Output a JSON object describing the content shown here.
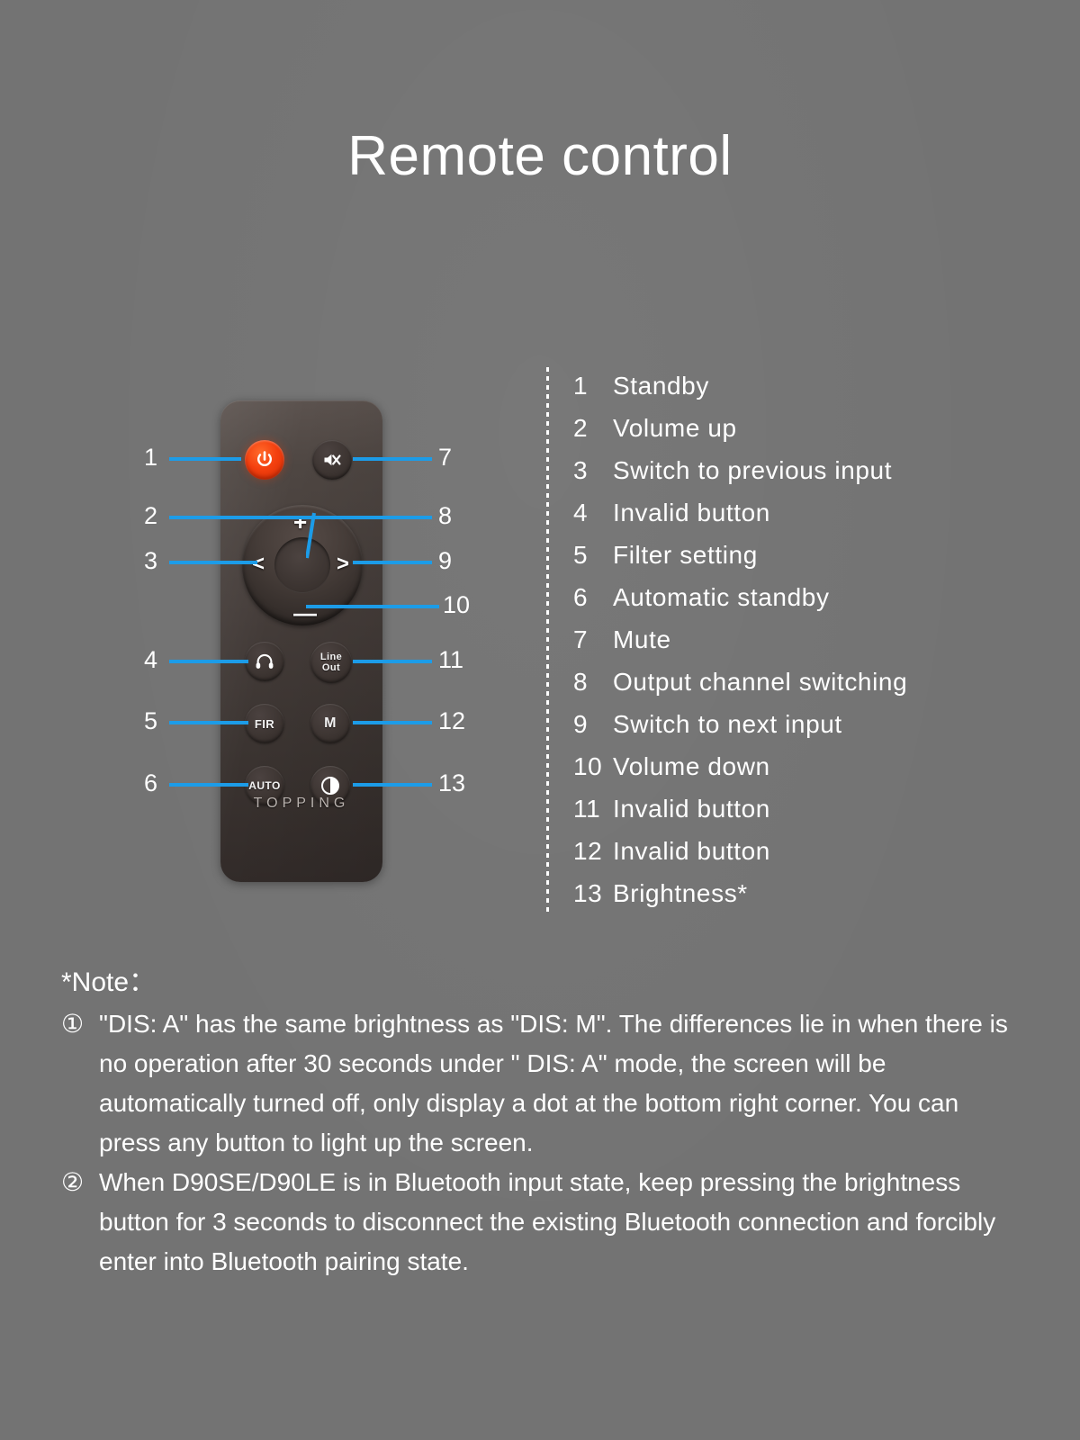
{
  "page": {
    "title": "Remote control",
    "background_color": "#737373",
    "accent_color": "#1c9ce8",
    "power_button_color": "#f4400f"
  },
  "remote": {
    "brand": "TOPPING",
    "buttons": {
      "power": "power-icon",
      "mute": "mute-icon",
      "plus": "+",
      "minus": "—",
      "left": "<",
      "right": ">",
      "headphone": "headphone-icon",
      "line_out_line1": "Line",
      "line_out_line2": "Out",
      "fir": "FIR",
      "m": "M",
      "auto": "AUTO",
      "brightness": "brightness-icon"
    },
    "callout_numbers_left": [
      "1",
      "2",
      "3",
      "4",
      "5",
      "6"
    ],
    "callout_numbers_right": [
      "7",
      "8",
      "9",
      "10",
      "11",
      "12",
      "13"
    ]
  },
  "legend": {
    "items": [
      {
        "num": "1",
        "label": "Standby"
      },
      {
        "num": "2",
        "label": "Volume up"
      },
      {
        "num": "3",
        "label": "Switch to previous input"
      },
      {
        "num": "4",
        "label": "Invalid button"
      },
      {
        "num": "5",
        "label": "Filter setting"
      },
      {
        "num": "6",
        "label": "Automatic standby"
      },
      {
        "num": "7",
        "label": "Mute"
      },
      {
        "num": "8",
        "label": "Output channel switching"
      },
      {
        "num": "9",
        "label": "Switch to next input"
      },
      {
        "num": "10",
        "label": "Volume down"
      },
      {
        "num": "11",
        "label": "Invalid button"
      },
      {
        "num": "12",
        "label": "Invalid button"
      },
      {
        "num": "13",
        "label": "Brightness*"
      }
    ]
  },
  "note": {
    "title": "*Note：",
    "items": [
      {
        "marker": "①",
        "text": "\"DIS: A\" has the same brightness as \"DIS: M\". The differences lie in when there is no operation after 30 seconds under \" DIS: A\" mode, the screen will be automatically turned off, only display a dot at the bottom right corner. You can press any button to light up the screen."
      },
      {
        "marker": "②",
        "text": "When D90SE/D90LE is in Bluetooth input state, keep pressing the brightness button for 3 seconds to disconnect the existing Bluetooth connection and forcibly enter into Bluetooth pairing state."
      }
    ]
  }
}
